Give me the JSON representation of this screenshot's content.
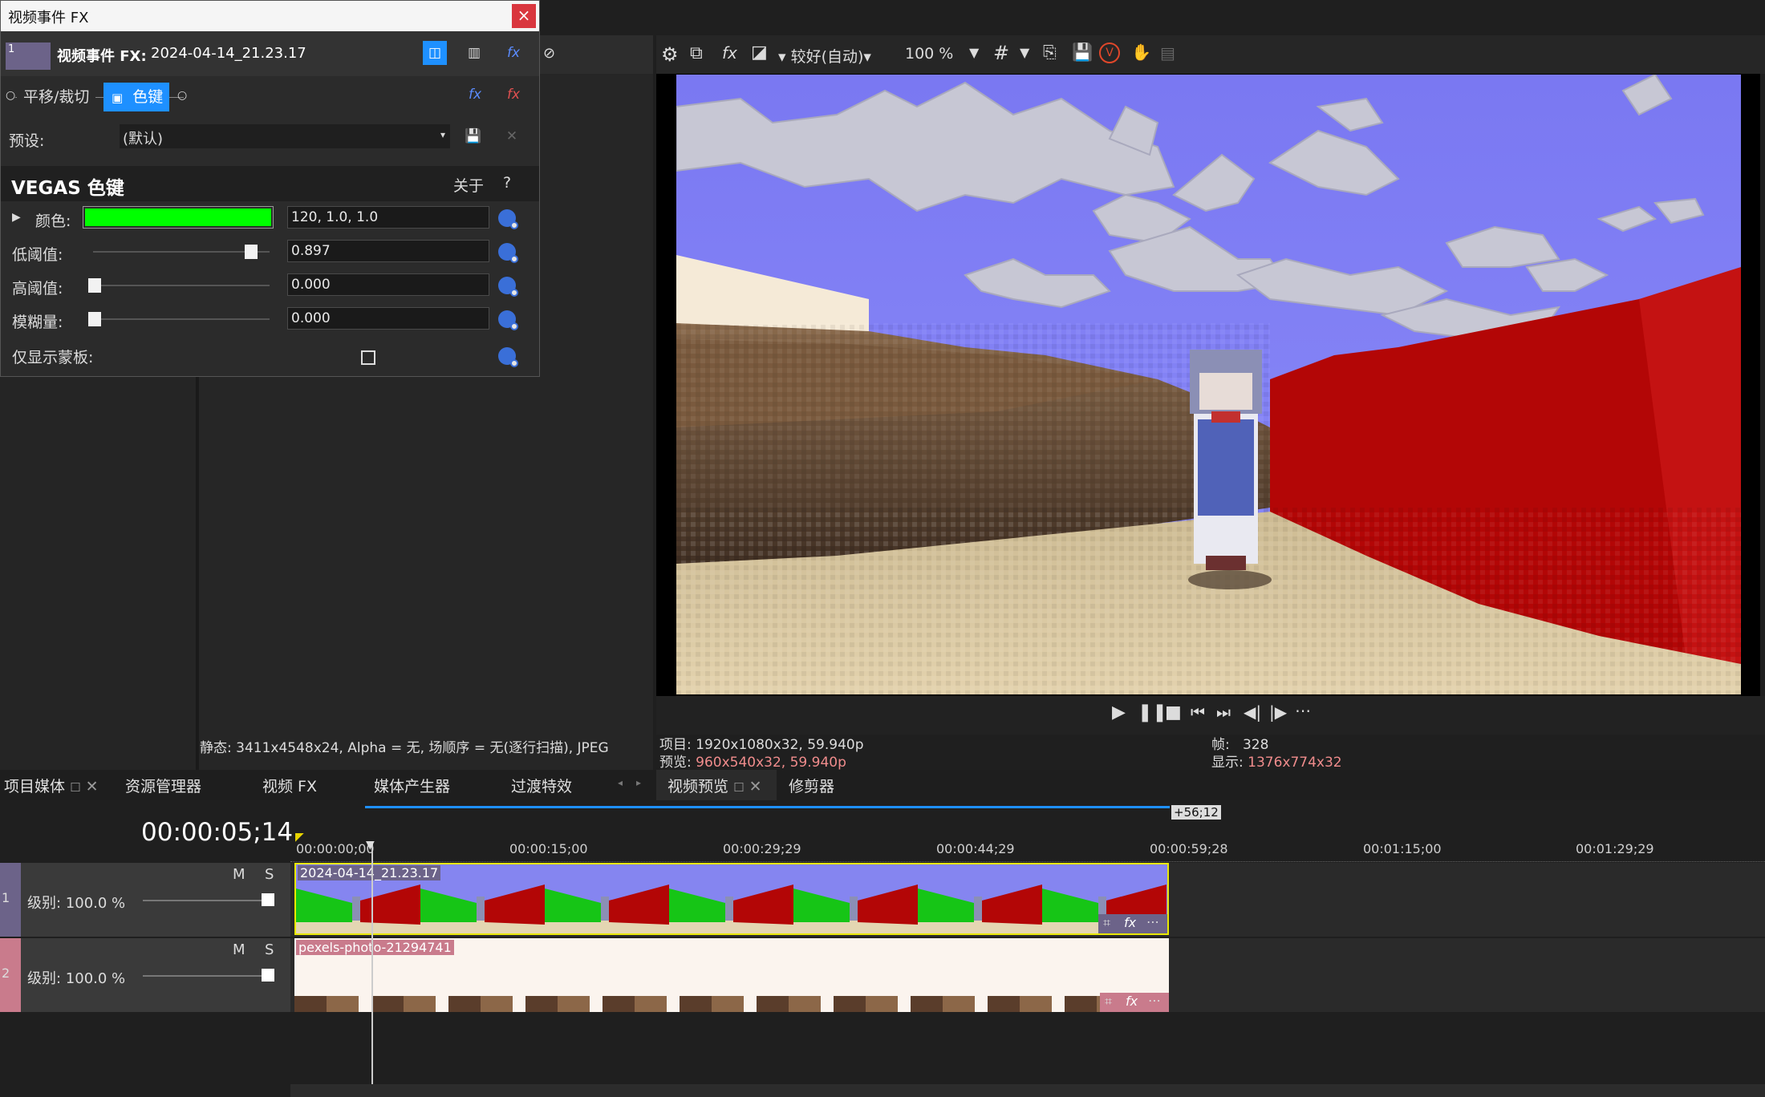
{
  "fx_window": {
    "title": "视频事件 FX",
    "close_glyph": "×",
    "header_label": "视频事件 FX:",
    "header_clip": "2024-04-14_21.23.17",
    "thumb_num": "1",
    "chain": {
      "pan_crop": "平移/裁切",
      "chroma_key": "色键"
    },
    "preset_label": "预设:",
    "preset_value": "(默认)",
    "plugin_name": "VEGAS 色键",
    "about": "关于",
    "help": "?",
    "params": {
      "color_label": "颜色:",
      "color_value": "120, 1.0, 1.0",
      "color_swatch": "#00ff00",
      "low_label": "低阈值:",
      "low_value": "0.897",
      "low_level": 0.897,
      "high_label": "高阈值:",
      "high_value": "0.000",
      "blur_label": "模糊量:",
      "blur_value": "0.000",
      "mask_label": "仅显示蒙板:"
    }
  },
  "preview_toolbar": {
    "quality": "较好(自动)",
    "zoom": "100 %"
  },
  "media_info": "静态: 3411x4548x24, Alpha = 无, 场顺序 = 无(逐行扫描), JPEG",
  "preview_info": {
    "project_label": "项目:",
    "project_value": "1920x1080x32, 59.940p",
    "preview_label": "预览:",
    "preview_value": "960x540x32, 59.940p",
    "frame_label": "帧:",
    "frame_value": "328",
    "display_label": "显示:",
    "display_value": "1376x774x32"
  },
  "tabs": {
    "project_media": "项目媒体",
    "explorer": "资源管理器",
    "video_fx": "视频 FX",
    "media_generators": "媒体产生器",
    "transitions": "过渡特效",
    "video_preview": "视频预览",
    "trimmer": "修剪器"
  },
  "timeline": {
    "timecode": "00:00:05;14",
    "loop_length": "+56;12",
    "ruler": [
      "00:00:00;00",
      "00:00:15;00",
      "00:00:29;29",
      "00:00:44;29",
      "00:00:59;28",
      "00:01:15;00",
      "00:01:29;29"
    ],
    "tracks": [
      {
        "num": "1",
        "level": "级别: 100.0 %",
        "m": "M",
        "s": "S",
        "clip": "2024-04-14_21.23.17"
      },
      {
        "num": "2",
        "level": "级别: 100.0 %",
        "m": "M",
        "s": "S",
        "clip": "pexels-photo-21294741"
      }
    ]
  },
  "colors": {
    "accent": "#1e90ff",
    "track1": "#6c6389",
    "track2": "#c97b8c",
    "selected_border": "#e8e800"
  }
}
